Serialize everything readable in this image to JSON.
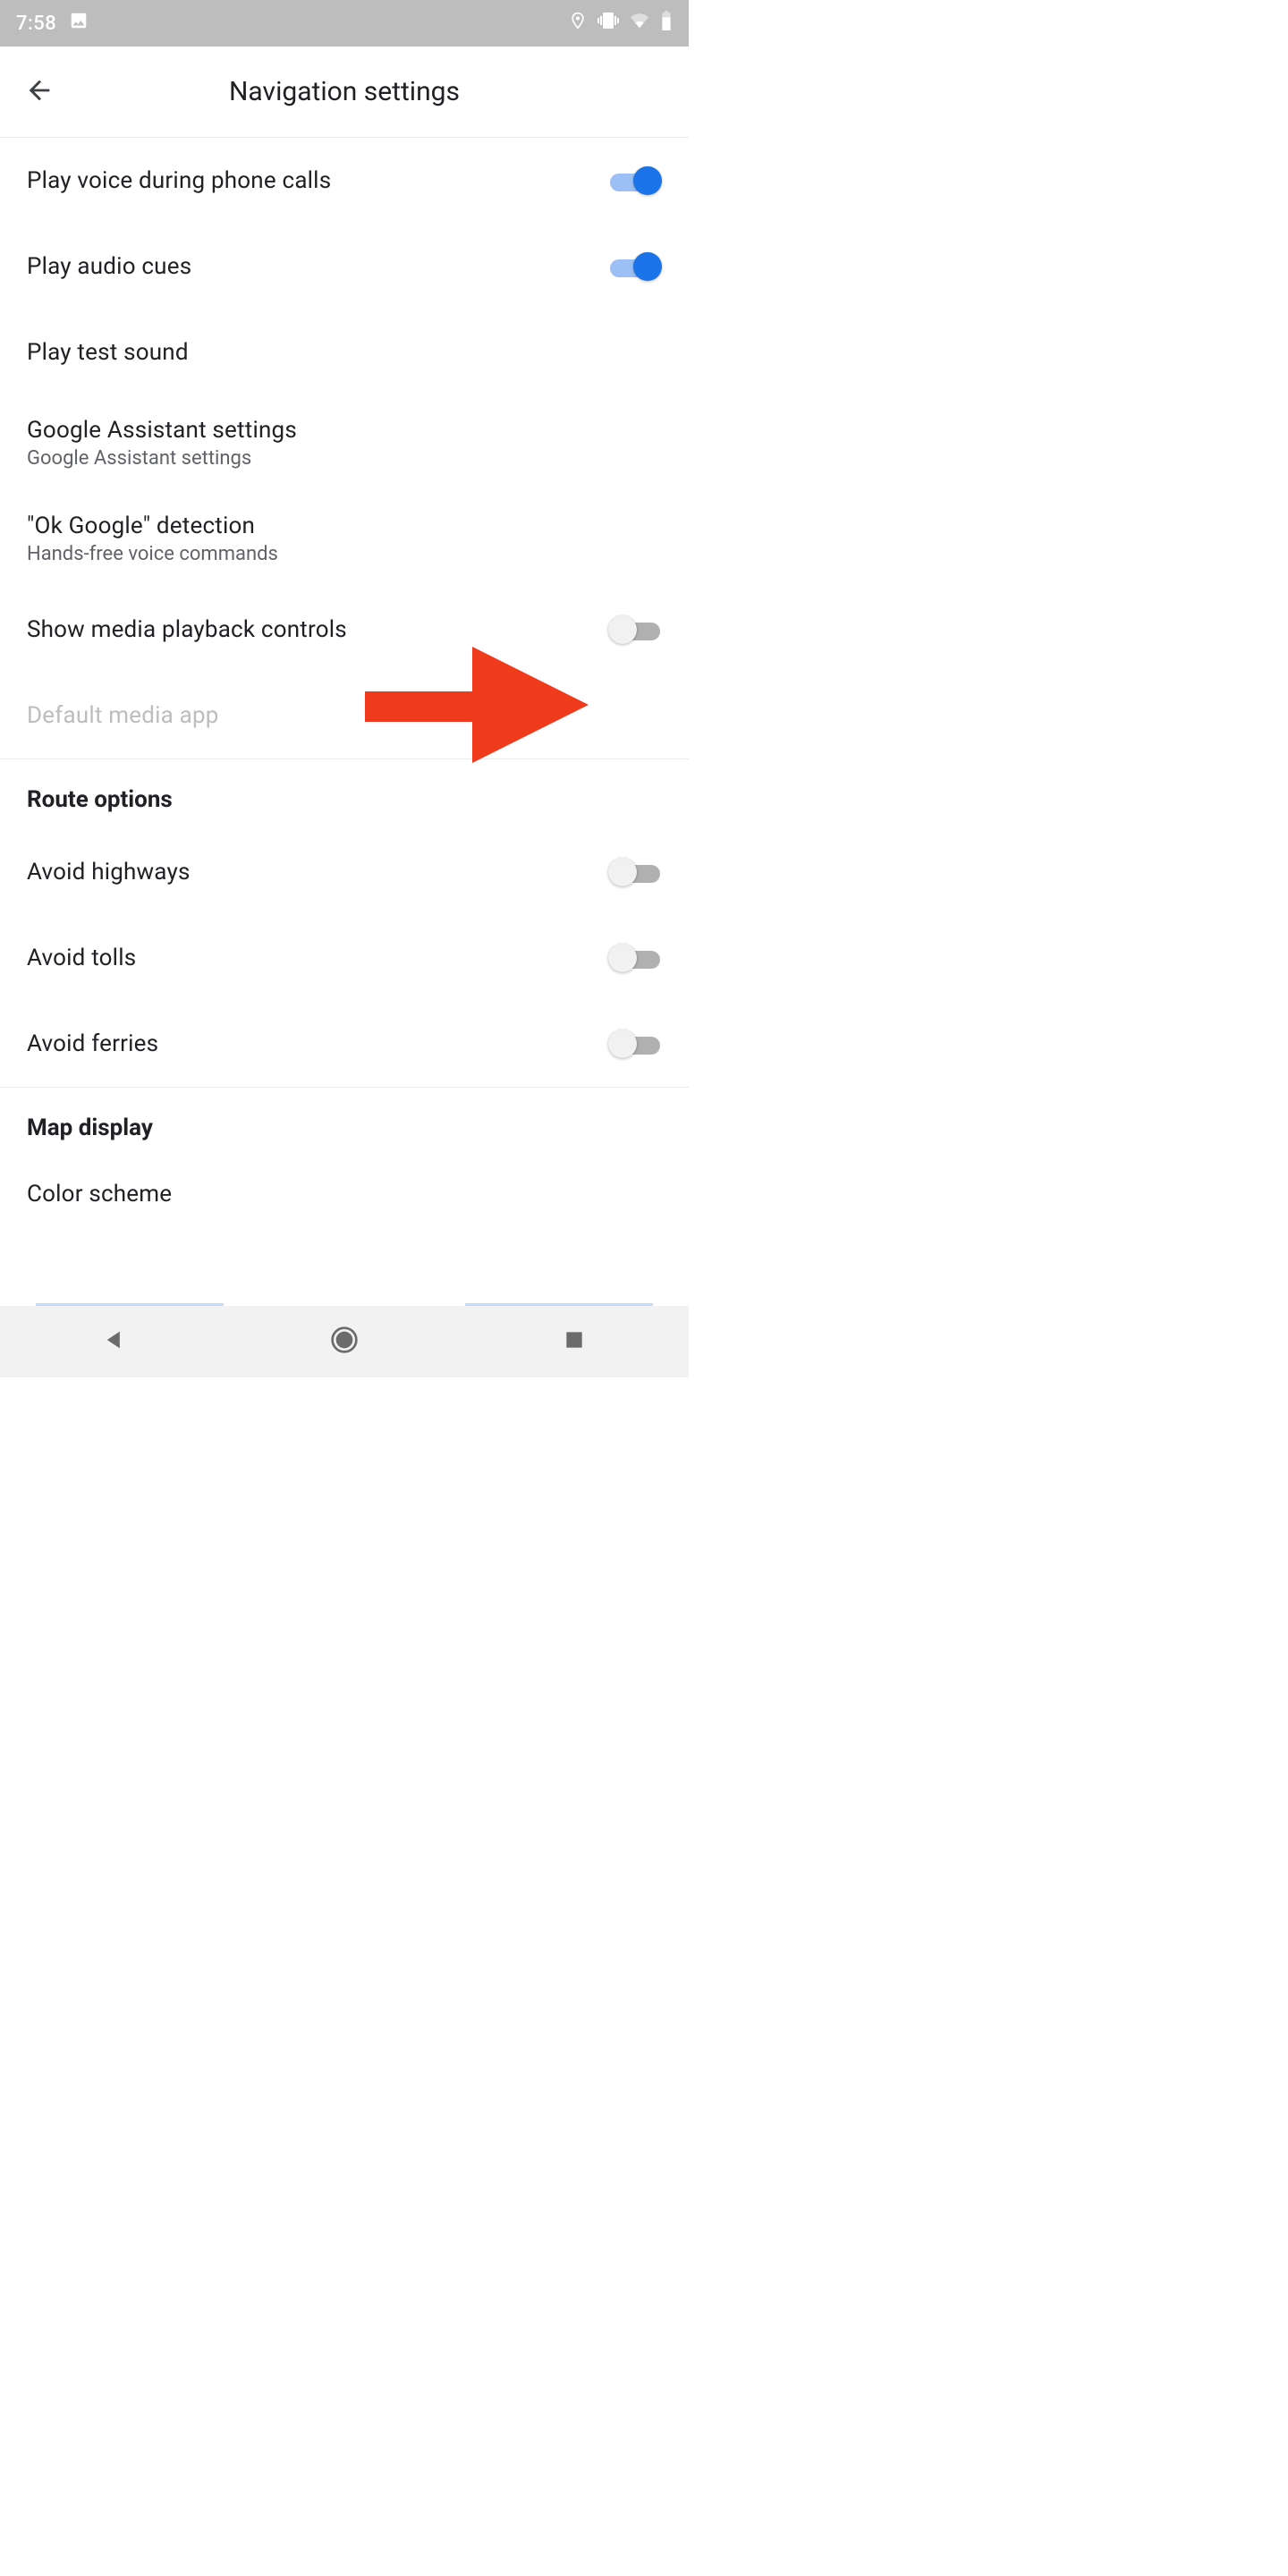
{
  "status": {
    "time": "7:58"
  },
  "header": {
    "title": "Navigation settings"
  },
  "rows": {
    "voice_calls": {
      "label": "Play voice during phone calls",
      "on": true
    },
    "audio_cues": {
      "label": "Play audio cues",
      "on": true
    },
    "test_sound": {
      "label": "Play test sound"
    },
    "assistant": {
      "label": "Google Assistant settings",
      "sub": "Google Assistant settings"
    },
    "ok_google": {
      "label": "\"Ok Google\" detection",
      "sub": "Hands-free voice commands"
    },
    "media_controls": {
      "label": "Show media playback controls",
      "on": false
    },
    "default_media": {
      "label": "Default media app"
    }
  },
  "sections": {
    "route_options": "Route options",
    "map_display": "Map display"
  },
  "route": {
    "highways": {
      "label": "Avoid highways",
      "on": false
    },
    "tolls": {
      "label": "Avoid tolls",
      "on": false
    },
    "ferries": {
      "label": "Avoid ferries",
      "on": false
    }
  },
  "map_display": {
    "color_scheme": {
      "label": "Color scheme"
    }
  }
}
